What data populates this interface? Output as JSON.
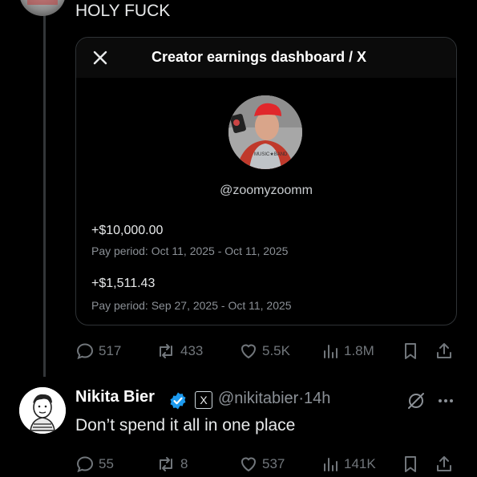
{
  "tweet": {
    "text": "HOLY FUCK",
    "stats": {
      "replies": "517",
      "retweets": "433",
      "likes": "5.5K",
      "views": "1.8M"
    }
  },
  "card": {
    "title": "Creator earnings dashboard / X",
    "handle": "@zoomyzoomm",
    "shirt_text": "MUSIC★BAND",
    "payouts": [
      {
        "amount": "+$10,000.00",
        "period": "Pay period: Oct 11, 2025 - Oct 11, 2025"
      },
      {
        "amount": "+$1,511.43",
        "period": "Pay period: Sep 27, 2025 - Oct 11, 2025"
      }
    ]
  },
  "reply": {
    "name": "Nikita Bier",
    "handle": "@nikitabier",
    "separator": "·",
    "time": "14h",
    "affiliate_badge": "X",
    "text": "Don’t spend it all in one place",
    "stats": {
      "replies": "55",
      "retweets": "8",
      "likes": "537",
      "views": "141K"
    }
  },
  "colors": {
    "background": "#000000",
    "text": "#e7e9ea",
    "muted": "#71767b",
    "verified": "#1d9bf0",
    "card_border": "#2f3336"
  },
  "icons": [
    "close-icon",
    "reply-icon",
    "retweet-icon",
    "like-icon",
    "views-icon",
    "bookmark-icon",
    "share-icon",
    "verified-icon",
    "grok-icon",
    "more-icon"
  ]
}
